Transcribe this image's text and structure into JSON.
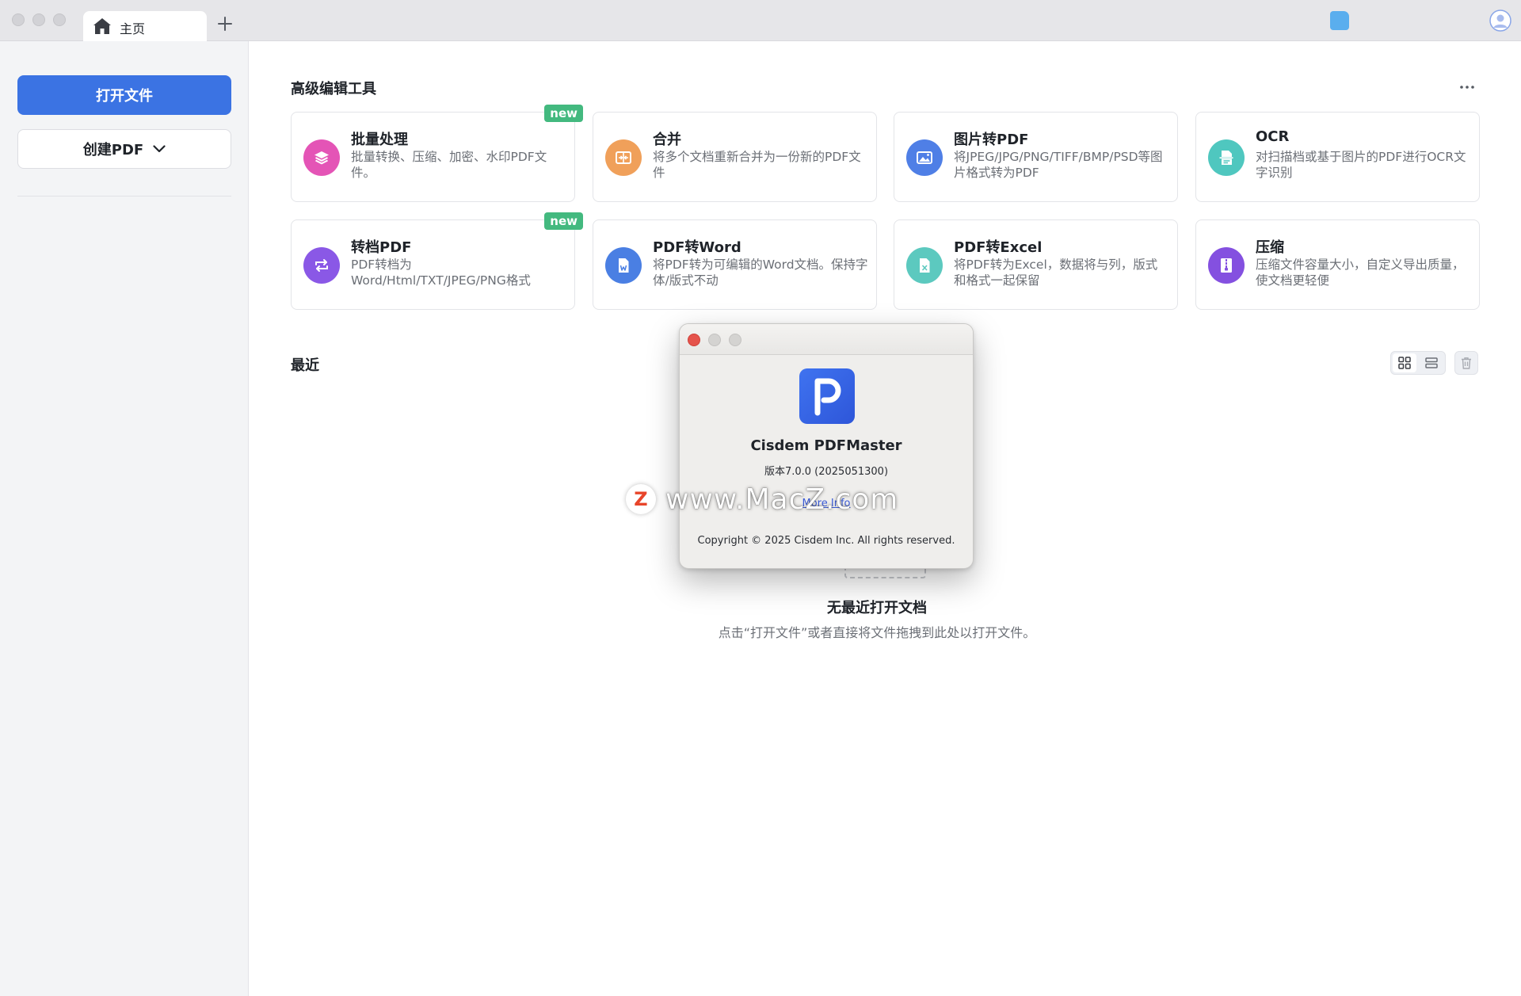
{
  "titlebar": {
    "tab_label": "主页"
  },
  "sidebar": {
    "open_file_label": "打开文件",
    "create_pdf_label": "创建PDF"
  },
  "main": {
    "tools_section_title": "高级编辑工具",
    "tools": [
      {
        "title": "批量处理",
        "desc": "批量转换、压缩、加密、水印PDF文件。",
        "badge": "new",
        "icon": "layers-icon",
        "color": "#e454b6"
      },
      {
        "title": "合并",
        "desc": "将多个文档重新合并为一份新的PDF文件",
        "badge": "",
        "icon": "merge-icon",
        "color": "#f0a05a"
      },
      {
        "title": "图片转PDF",
        "desc": "将JPEG/JPG/PNG/TIFF/BMP/PSD等图片格式转为PDF",
        "badge": "",
        "icon": "image-icon",
        "color": "#4f7fe6"
      },
      {
        "title": "OCR",
        "desc": "对扫描档或基于图片的PDF进行OCR文字识别",
        "badge": "",
        "icon": "scan-document-icon",
        "color": "#4fc7bf"
      },
      {
        "title": "转档PDF",
        "desc": "PDF转档为Word/Html/TXT/JPEG/PNG格式",
        "badge": "new",
        "icon": "convert-icon",
        "color": "#8a58e6"
      },
      {
        "title": "PDF转Word",
        "desc": "将PDF转为可编辑的Word文档。保持字体/版式不动",
        "badge": "",
        "icon": "word-document-icon",
        "color": "#4a7fe3"
      },
      {
        "title": "PDF转Excel",
        "desc": "将PDF转为Excel，数据将与列，版式和格式一起保留",
        "badge": "",
        "icon": "excel-document-icon",
        "color": "#5cc9bf"
      },
      {
        "title": "压缩",
        "desc": "压缩文件容量大小，自定义导出质量，使文档更轻便",
        "badge": "",
        "icon": "zip-icon",
        "color": "#8450e0"
      }
    ],
    "recent_section_title": "最近",
    "empty_title": "无最近打开文档",
    "empty_subtitle": "点击“打开文件”或者直接将文件拖拽到此处以打开文件。"
  },
  "about_dialog": {
    "app_name": "Cisdem PDFMaster",
    "version": "版本7.0.0 (2025051300)",
    "link_text": "More Info",
    "copyright": "Copyright © 2025 Cisdem Inc. All rights reserved."
  },
  "watermark": {
    "text": "www.MacZ.com",
    "logo_letter": "Z"
  },
  "colors": {
    "accent": "#3b73e3",
    "badge": "#43b97f",
    "close_button": "#e5534b"
  }
}
